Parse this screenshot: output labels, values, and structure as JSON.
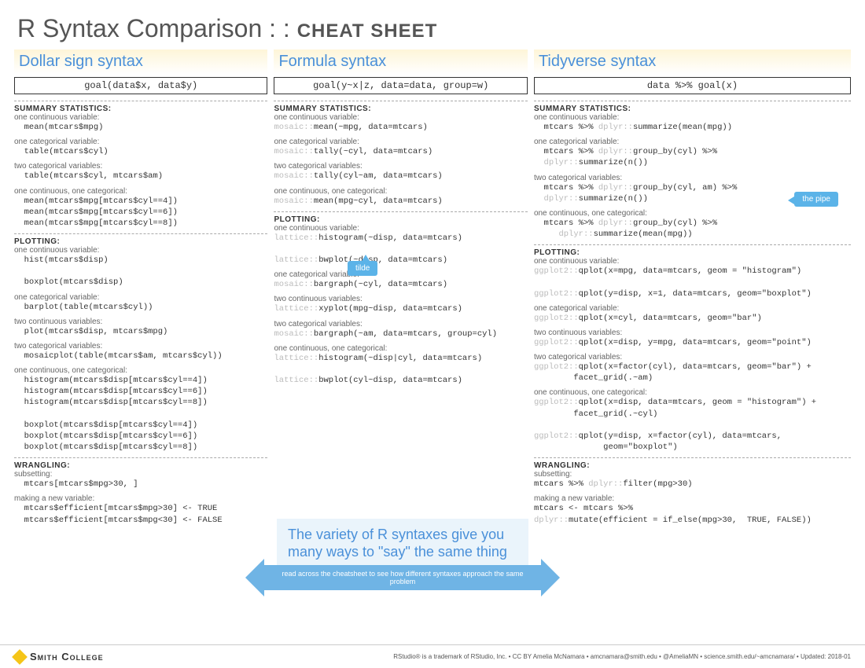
{
  "title_light": "R Syntax Comparison : : ",
  "title_bold": "CHEAT SHEET",
  "pipe_label": "the pipe",
  "tilde_label": "tilde",
  "callout_title": "The variety of R syntaxes give you many ways to \"say\" the same thing",
  "callout_arrow": "read across the cheatsheet to see how different syntaxes approach the same problem",
  "footer_logo": "Smith College",
  "footer_credits": "RStudio® is a trademark of RStudio, Inc.  •  CC BY Amelia McNamara  •  amcnamara@smith.edu  •  @AmeliaMN  •  science.smith.edu/~amcnamara/  •  Updated: 2018-01",
  "cols": [
    {
      "heading": "Dollar sign syntax",
      "goal": "goal(data$x, data$y)",
      "sections": [
        {
          "title": "SUMMARY STATISTICS:",
          "items": [
            {
              "label": "one continuous variable:",
              "code": "  mean(mtcars$mpg)"
            },
            {
              "label": "one categorical variable:",
              "code": "  table(mtcars$cyl)"
            },
            {
              "label": "two categorical variables:",
              "code": "  table(mtcars$cyl, mtcars$am)"
            },
            {
              "label": "one continuous, one categorical:",
              "code": "  mean(mtcars$mpg[mtcars$cyl==4])\n  mean(mtcars$mpg[mtcars$cyl==6])\n  mean(mtcars$mpg[mtcars$cyl==8])"
            }
          ]
        },
        {
          "title": "PLOTTING:",
          "items": [
            {
              "label": "one continuous variable:",
              "code": "  hist(mtcars$disp)\n\n  boxplot(mtcars$disp)"
            },
            {
              "label": "one categorical variable:",
              "code": "  barplot(table(mtcars$cyl))"
            },
            {
              "label": "two continuous variables:",
              "code": "  plot(mtcars$disp, mtcars$mpg)"
            },
            {
              "label": "two categorical variables:",
              "code": "  mosaicplot(table(mtcars$am, mtcars$cyl))"
            },
            {
              "label": "one continuous, one categorical:",
              "code": "  histogram(mtcars$disp[mtcars$cyl==4])\n  histogram(mtcars$disp[mtcars$cyl==6])\n  histogram(mtcars$disp[mtcars$cyl==8])\n\n  boxplot(mtcars$disp[mtcars$cyl==4])\n  boxplot(mtcars$disp[mtcars$cyl==6])\n  boxplot(mtcars$disp[mtcars$cyl==8])"
            }
          ]
        },
        {
          "title": "WRANGLING:",
          "items": [
            {
              "label": "subsetting:",
              "code": "  mtcars[mtcars$mpg>30, ]"
            },
            {
              "label": "making a new variable:",
              "code": "  mtcars$efficient[mtcars$mpg>30] <- TRUE\n  mtcars$efficient[mtcars$mpg<30] <- FALSE"
            }
          ]
        }
      ]
    },
    {
      "heading": "Formula syntax",
      "goal": "goal(y~x|z, data=data, group=w)",
      "sections": [
        {
          "title": "SUMMARY STATISTICS:",
          "items": [
            {
              "label": "one continuous variable:",
              "code": "<span class='pkg'>mosaic::</span>mean(~mpg, data=mtcars)"
            },
            {
              "label": "one categorical variable:",
              "code": "<span class='pkg'>mosaic::</span>tally(~cyl, data=mtcars)"
            },
            {
              "label": "two categorical variables:",
              "code": "<span class='pkg'>mosaic::</span>tally(cyl~am, data=mtcars)"
            },
            {
              "label": "one continuous, one categorical:",
              "code": "<span class='pkg'>mosaic::</span>mean(mpg~cyl, data=mtcars)"
            }
          ]
        },
        {
          "title": "PLOTTING:",
          "items": [
            {
              "label": "one continuous variable:",
              "code": "<span class='pkg'>lattice::</span>histogram(~disp, data=mtcars)\n\n<span class='pkg'>lattice::</span>bwplot(~disp, data=mtcars)"
            },
            {
              "label": "one categorical variable:",
              "code": "<span class='pkg'>mosaic::</span>bargraph(~cyl, data=mtcars)"
            },
            {
              "label": "two continuous variables:",
              "code": "<span class='pkg'>lattice::</span>xyplot(mpg~disp, data=mtcars)"
            },
            {
              "label": "two categorical variables:",
              "code": "<span class='pkg'>mosaic::</span>bargraph(~am, data=mtcars, group=cyl)"
            },
            {
              "label": "one continuous, one categorical:",
              "code": "<span class='pkg'>lattice::</span>histogram(~disp|cyl, data=mtcars)\n\n<span class='pkg'>lattice::</span>bwplot(cyl~disp, data=mtcars)"
            }
          ]
        }
      ]
    },
    {
      "heading": "Tidyverse syntax",
      "goal": "data %>% goal(x)",
      "sections": [
        {
          "title": "SUMMARY STATISTICS:",
          "items": [
            {
              "label": "one continuous variable:",
              "code": "  mtcars %>% <span class='pkg'>dplyr::</span>summarize(mean(mpg))"
            },
            {
              "label": "one categorical variable:",
              "code": "  mtcars %>% <span class='pkg'>dplyr::</span>group_by(cyl) %>%\n  <span class='pkg'>dplyr::</span>summarize(n())"
            },
            {
              "label": "two categorical variables:",
              "code": "  mtcars %>% <span class='pkg'>dplyr::</span>group_by(cyl, am) %>%\n  <span class='pkg'>dplyr::</span>summarize(n())"
            },
            {
              "label": "one continuous, one categorical:",
              "code": "  mtcars %>% <span class='pkg'>dplyr::</span>group_by(cyl) %>%\n     <span class='pkg'>dplyr::</span>summarize(mean(mpg))"
            }
          ]
        },
        {
          "title": "PLOTTING:",
          "items": [
            {
              "label": "one continuous variable:",
              "code": "<span class='pkg'>ggplot2::</span>qplot(x=mpg, data=mtcars, geom = \"histogram\")\n\n<span class='pkg'>ggplot2::</span>qplot(y=disp, x=1, data=mtcars, geom=\"boxplot\")"
            },
            {
              "label": "one categorical variable:",
              "code": "<span class='pkg'>ggplot2::</span>qplot(x=cyl, data=mtcars, geom=\"bar\")"
            },
            {
              "label": "two continuous variables:",
              "code": "<span class='pkg'>ggplot2::</span>qplot(x=disp, y=mpg, data=mtcars, geom=\"point\")"
            },
            {
              "label": "two categorical variables:",
              "code": "<span class='pkg'>ggplot2::</span>qplot(x=factor(cyl), data=mtcars, geom=\"bar\") +\n        facet_grid(.~am)"
            },
            {
              "label": "one continuous, one categorical:",
              "code": "<span class='pkg'>ggplot2::</span>qplot(x=disp, data=mtcars, geom = \"histogram\") +\n        facet_grid(.~cyl)\n\n<span class='pkg'>ggplot2::</span>qplot(y=disp, x=factor(cyl), data=mtcars,\n              geom=\"boxplot\")"
            }
          ]
        },
        {
          "title": "WRANGLING:",
          "items": [
            {
              "label": "subsetting:",
              "code": "mtcars %>% <span class='pkg'>dplyr::</span>filter(mpg>30)"
            },
            {
              "label": "making a new variable:",
              "code": "mtcars <- mtcars %>%\n<span class='pkg'>dplyr::</span>mutate(efficient = if_else(mpg>30,  TRUE, FALSE))"
            }
          ]
        }
      ]
    }
  ]
}
